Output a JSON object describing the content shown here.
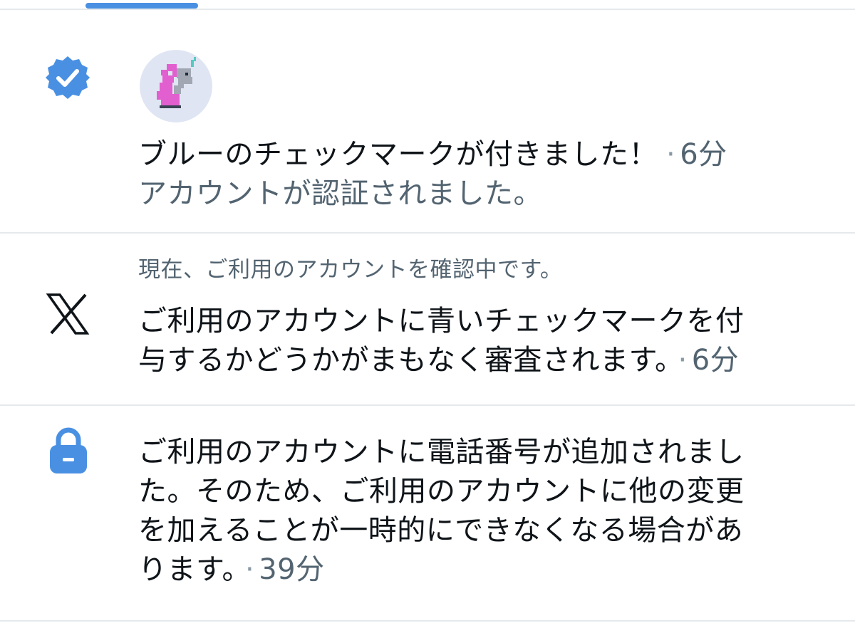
{
  "colors": {
    "accent": "#4a90e2",
    "primary_text": "#0f1419",
    "secondary_text": "#536471",
    "divider": "#e6e9ec"
  },
  "notifications": [
    {
      "icon": "verified-badge-icon",
      "title": "ブルーのチェックマークが付きました！",
      "time": "6分",
      "body": "アカウントが認証されました。"
    },
    {
      "icon": "x-logo-icon",
      "header": "現在、ご利用のアカウントを確認中です。",
      "body_lines": [
        "ご利用のアカウントに青いチェックマークを付",
        "与するかどうかがまもなく審査されます。"
      ],
      "time": "6分"
    },
    {
      "icon": "lock-icon",
      "body_lines": [
        "ご利用のアカウントに電話番号が追加されまし",
        "た。そのため、ご利用のアカウントに他の変更",
        "を加えることが一時的にできなくなる場合があ",
        "ります。"
      ],
      "time": "39分"
    }
  ],
  "separator": "·"
}
